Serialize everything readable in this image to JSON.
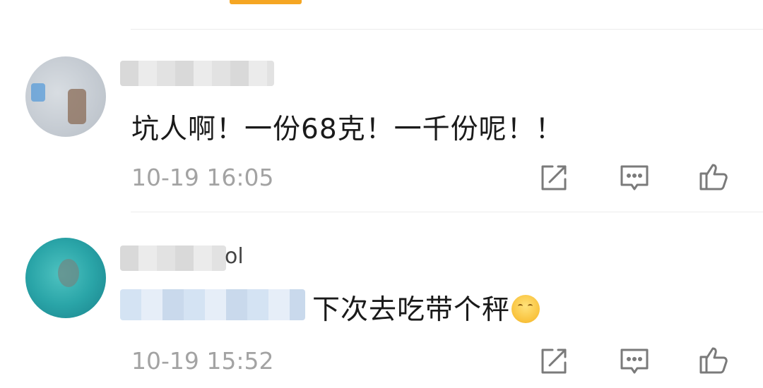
{
  "comments": [
    {
      "name_suffix": "",
      "text": "坑人啊！一份68克！一千份呢！！",
      "time": "10-19 16:05"
    },
    {
      "name_suffix": "ol",
      "text": "下次去吃带个秤",
      "time": "10-19 15:52"
    }
  ],
  "icons": {
    "repost": "repost-icon",
    "comment": "comment-icon",
    "like": "like-icon",
    "emoji": "yawn-emoji-icon"
  },
  "colors": {
    "accent": "#f5a623",
    "timestamp": "#a3a3a3",
    "icon": "#7a7a7a"
  }
}
